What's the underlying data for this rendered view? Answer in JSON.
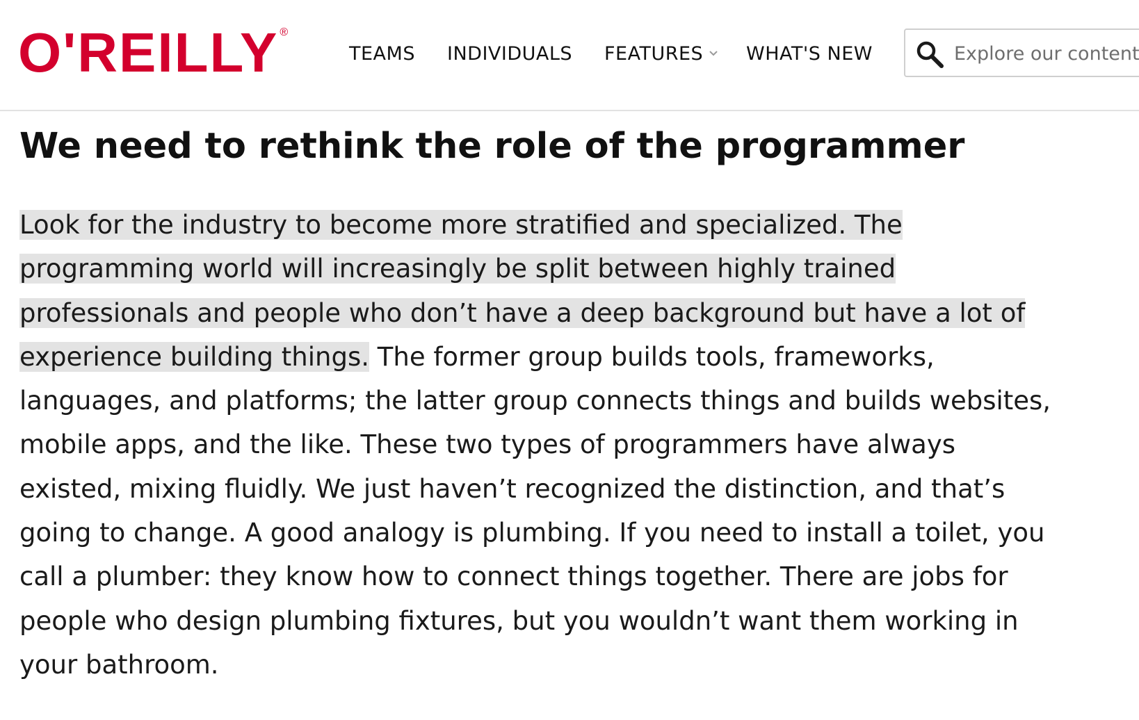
{
  "header": {
    "logo": "O'REILLY",
    "logo_mark": "®",
    "nav": [
      {
        "label": "TEAMS"
      },
      {
        "label": "INDIVIDUALS"
      },
      {
        "label": "FEATURES"
      },
      {
        "label": "WHAT'S NEW"
      }
    ],
    "search": {
      "placeholder": "Explore our content",
      "icon": "search-icon"
    }
  },
  "article": {
    "title": "We need to rethink the role of the programmer",
    "lines": [
      {
        "highlight": "Look for the industry to become more stratified and specialized. The",
        "rest": ""
      },
      {
        "highlight": "programming world will increasingly be split between highly trained",
        "rest": ""
      },
      {
        "highlight": "professionals and people who don’t have a deep background but have a lot of",
        "rest": ""
      },
      {
        "highlight": "experience building things.",
        "rest": " The former group builds tools, frameworks,"
      },
      {
        "highlight": "",
        "rest": "languages, and platforms; the latter group connects things and builds websites,"
      },
      {
        "highlight": "",
        "rest": "mobile apps, and the like. These two types of programmers have always"
      },
      {
        "highlight": "",
        "rest": "existed, mixing fluidly. We just haven’t recognized the distinction, and that’s"
      },
      {
        "highlight": "",
        "rest": "going to change. A good analogy is plumbing. If you need to install a toilet, you"
      },
      {
        "highlight": "",
        "rest": "call a plumber: they know how to connect things together. There are jobs for"
      },
      {
        "highlight": "",
        "rest": "people who design plumbing fixtures, but you wouldn’t want them working in"
      },
      {
        "highlight": "",
        "rest": "your bathroom."
      }
    ]
  },
  "colors": {
    "brand": "#d3002d",
    "highlight": "#e3e3e3",
    "text": "#1a1a1a"
  }
}
